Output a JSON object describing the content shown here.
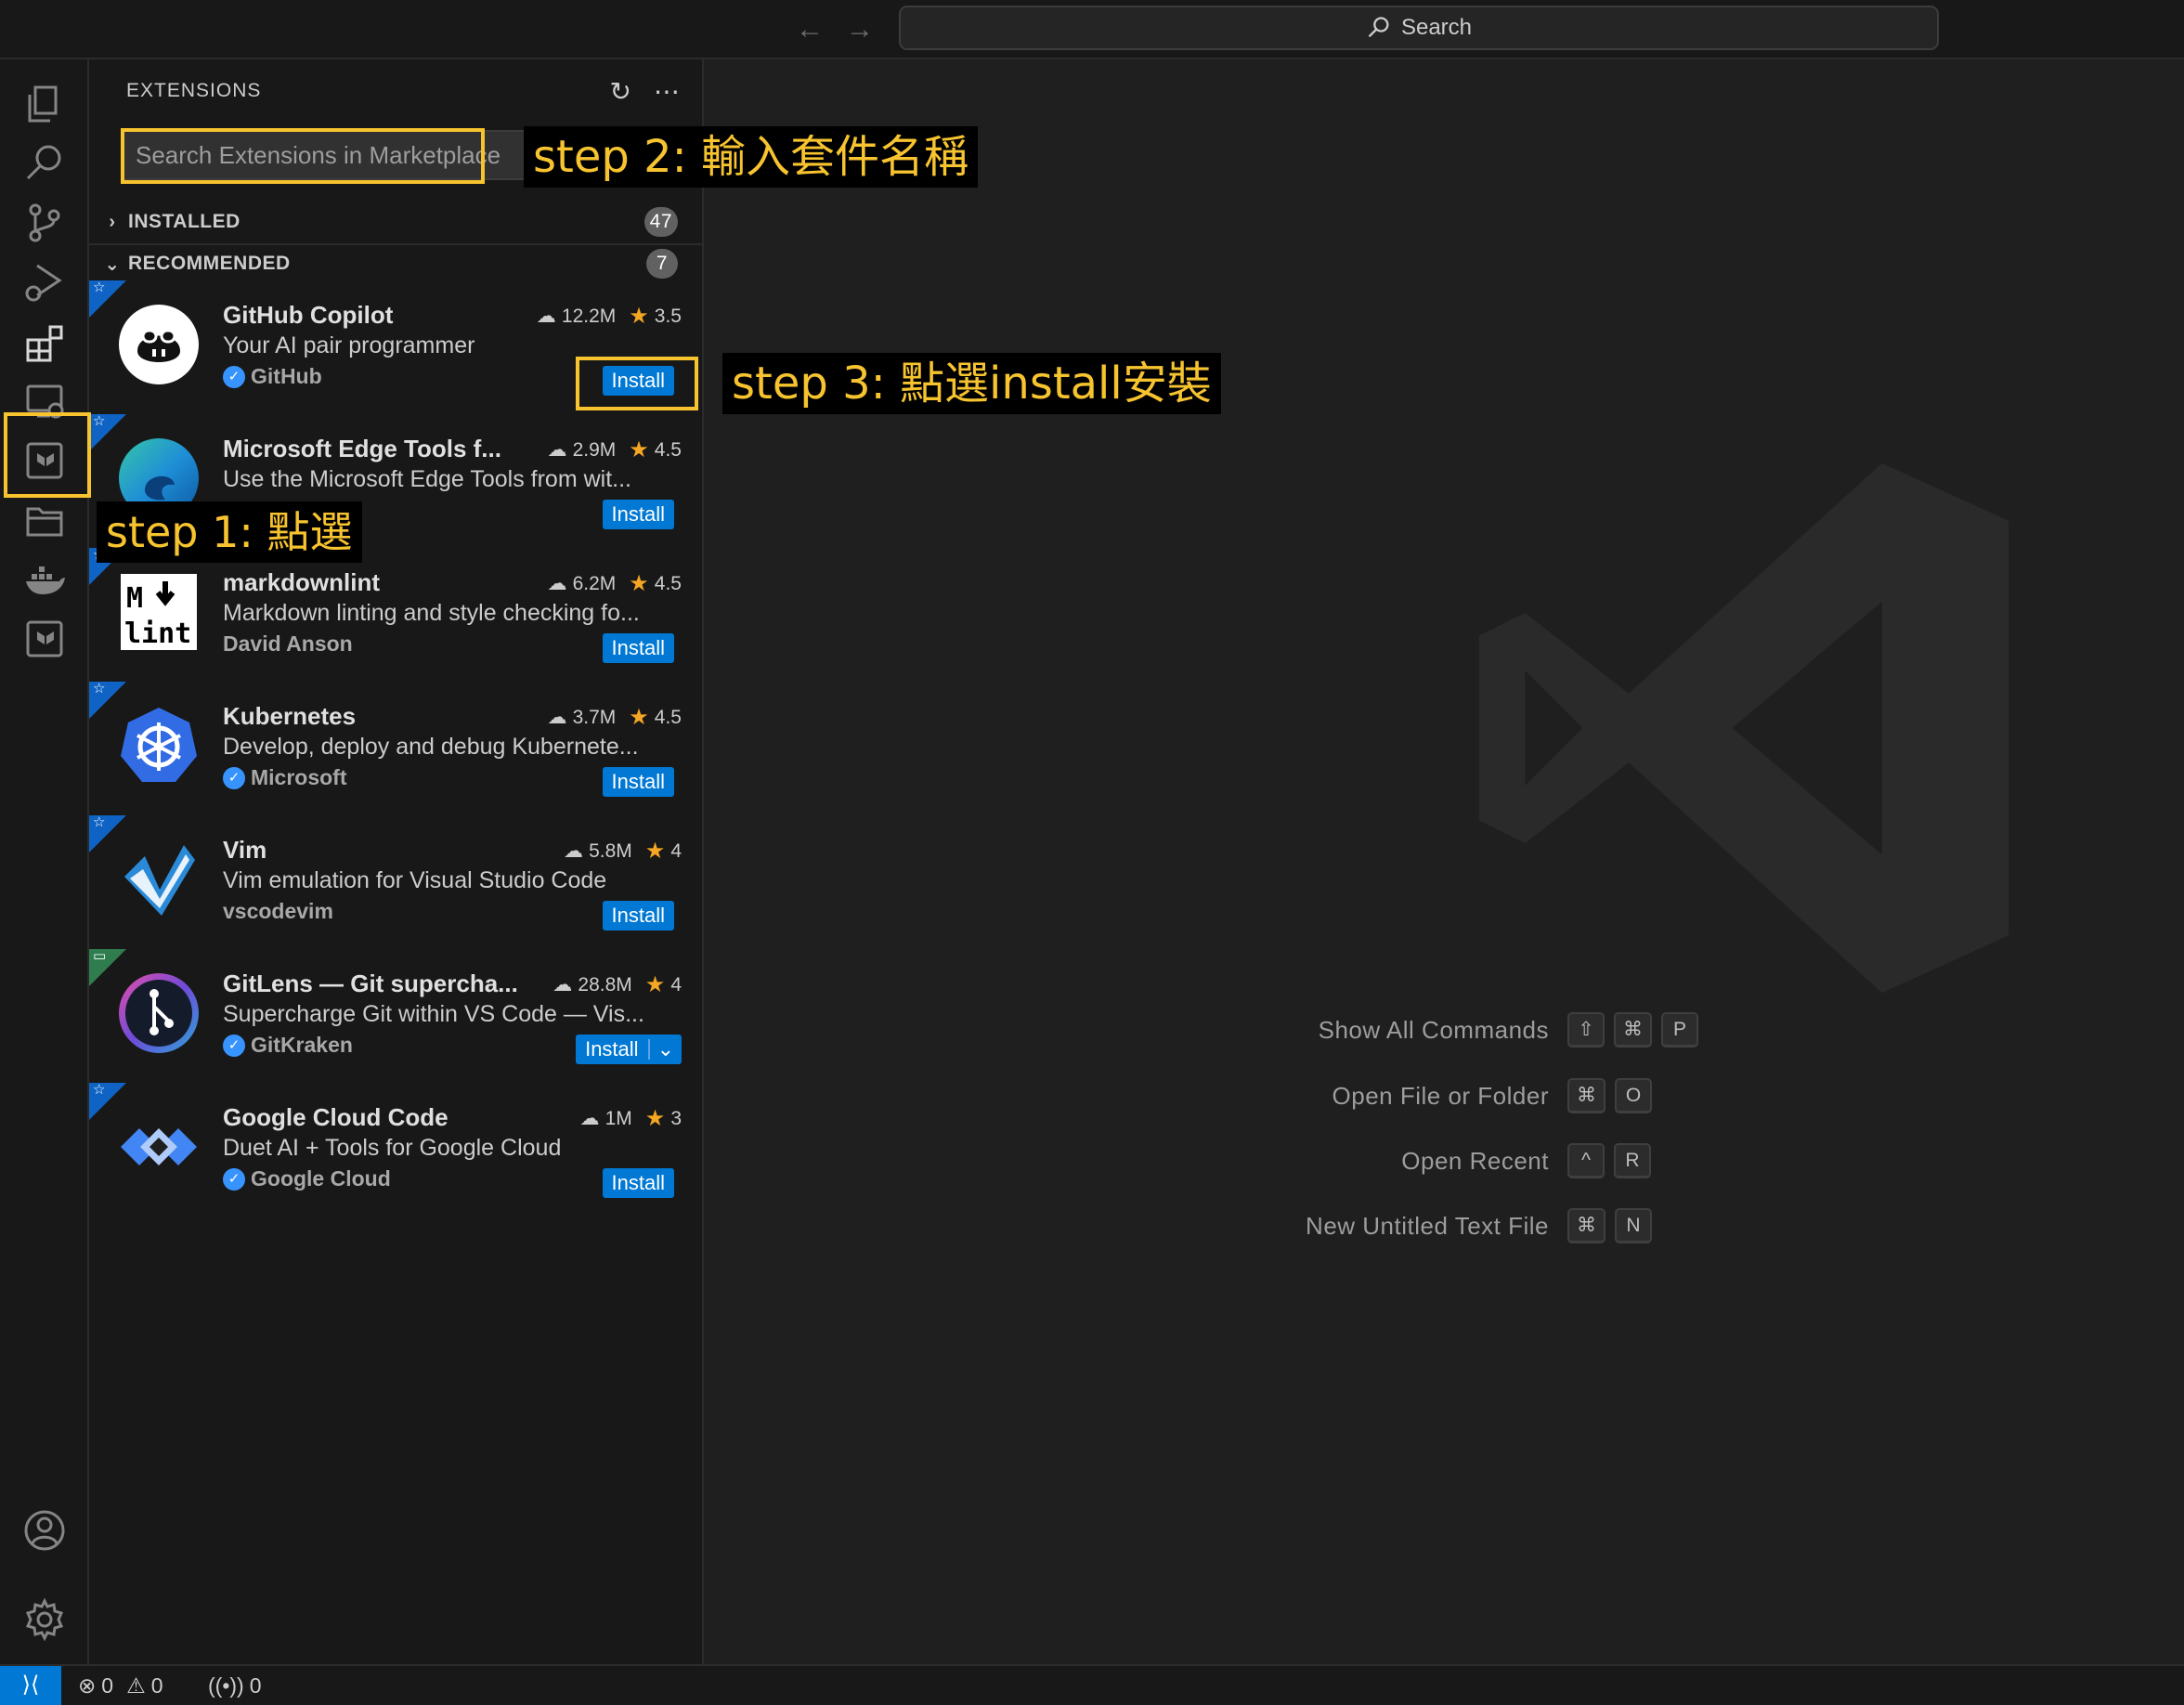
{
  "titlebar": {
    "back_icon": "arrow-left",
    "forward_icon": "arrow-right",
    "search_label": "Search"
  },
  "activitybar": {
    "items": [
      "explorer",
      "search",
      "source-control",
      "run-and-debug",
      "extensions",
      "remote-explorer",
      "terraform",
      "folders",
      "docker",
      "terraform-alt"
    ],
    "bottom": [
      "accounts",
      "manage"
    ]
  },
  "sidebar": {
    "title": "EXTENSIONS",
    "search_placeholder": "Search Extensions in Marketplace",
    "sections": [
      {
        "label": "INSTALLED",
        "count": "47",
        "expanded": false
      },
      {
        "label": "RECOMMENDED",
        "count": "7",
        "expanded": true
      }
    ],
    "extensions": [
      {
        "name": "GitHub Copilot",
        "downloads": "12.2M",
        "rating": "3.5",
        "desc": "Your AI pair programmer",
        "publisher": "GitHub",
        "verified": true,
        "action": "Install"
      },
      {
        "name": "Microsoft Edge Tools f...",
        "downloads": "2.9M",
        "rating": "4.5",
        "desc": "Use the Microsoft Edge Tools from wit...",
        "publisher": "",
        "verified": false,
        "action": "Install"
      },
      {
        "name": "markdownlint",
        "downloads": "6.2M",
        "rating": "4.5",
        "desc": "Markdown linting and style checking fo...",
        "publisher": "David Anson",
        "verified": false,
        "action": "Install"
      },
      {
        "name": "Kubernetes",
        "downloads": "3.7M",
        "rating": "4.5",
        "desc": "Develop, deploy and debug Kubernete...",
        "publisher": "Microsoft",
        "verified": true,
        "action": "Install"
      },
      {
        "name": "Vim",
        "downloads": "5.8M",
        "rating": "4",
        "desc": "Vim emulation for Visual Studio Code",
        "publisher": "vscodevim",
        "verified": false,
        "action": "Install"
      },
      {
        "name": "GitLens — Git supercha...",
        "downloads": "28.8M",
        "rating": "4",
        "desc": "Supercharge Git within VS Code — Vis...",
        "publisher": "GitKraken",
        "verified": true,
        "action": "Install"
      },
      {
        "name": "Google Cloud Code",
        "downloads": "1M",
        "rating": "3",
        "desc": "Duet AI + Tools for Google Cloud",
        "publisher": "Google Cloud",
        "verified": true,
        "action": "Install"
      }
    ]
  },
  "editor": {
    "shortcuts": [
      {
        "label": "Show All Commands",
        "keys": [
          "⇧",
          "⌘",
          "P"
        ]
      },
      {
        "label": "Open File or Folder",
        "keys": [
          "⌘",
          "O"
        ]
      },
      {
        "label": "Open Recent",
        "keys": [
          "^",
          "R"
        ]
      },
      {
        "label": "New Untitled Text File",
        "keys": [
          "⌘",
          "N"
        ]
      }
    ]
  },
  "statusbar": {
    "errors": "0",
    "warnings": "0",
    "ports": "0"
  },
  "annotations": {
    "step1": "step 1: 點選",
    "step2": "step 2: 輸入套件名稱",
    "step3": "step 3: 點選install安裝"
  },
  "colors": {
    "accent": "#0078d4",
    "annotation": "#f7c42f",
    "star": "#f5a623"
  }
}
